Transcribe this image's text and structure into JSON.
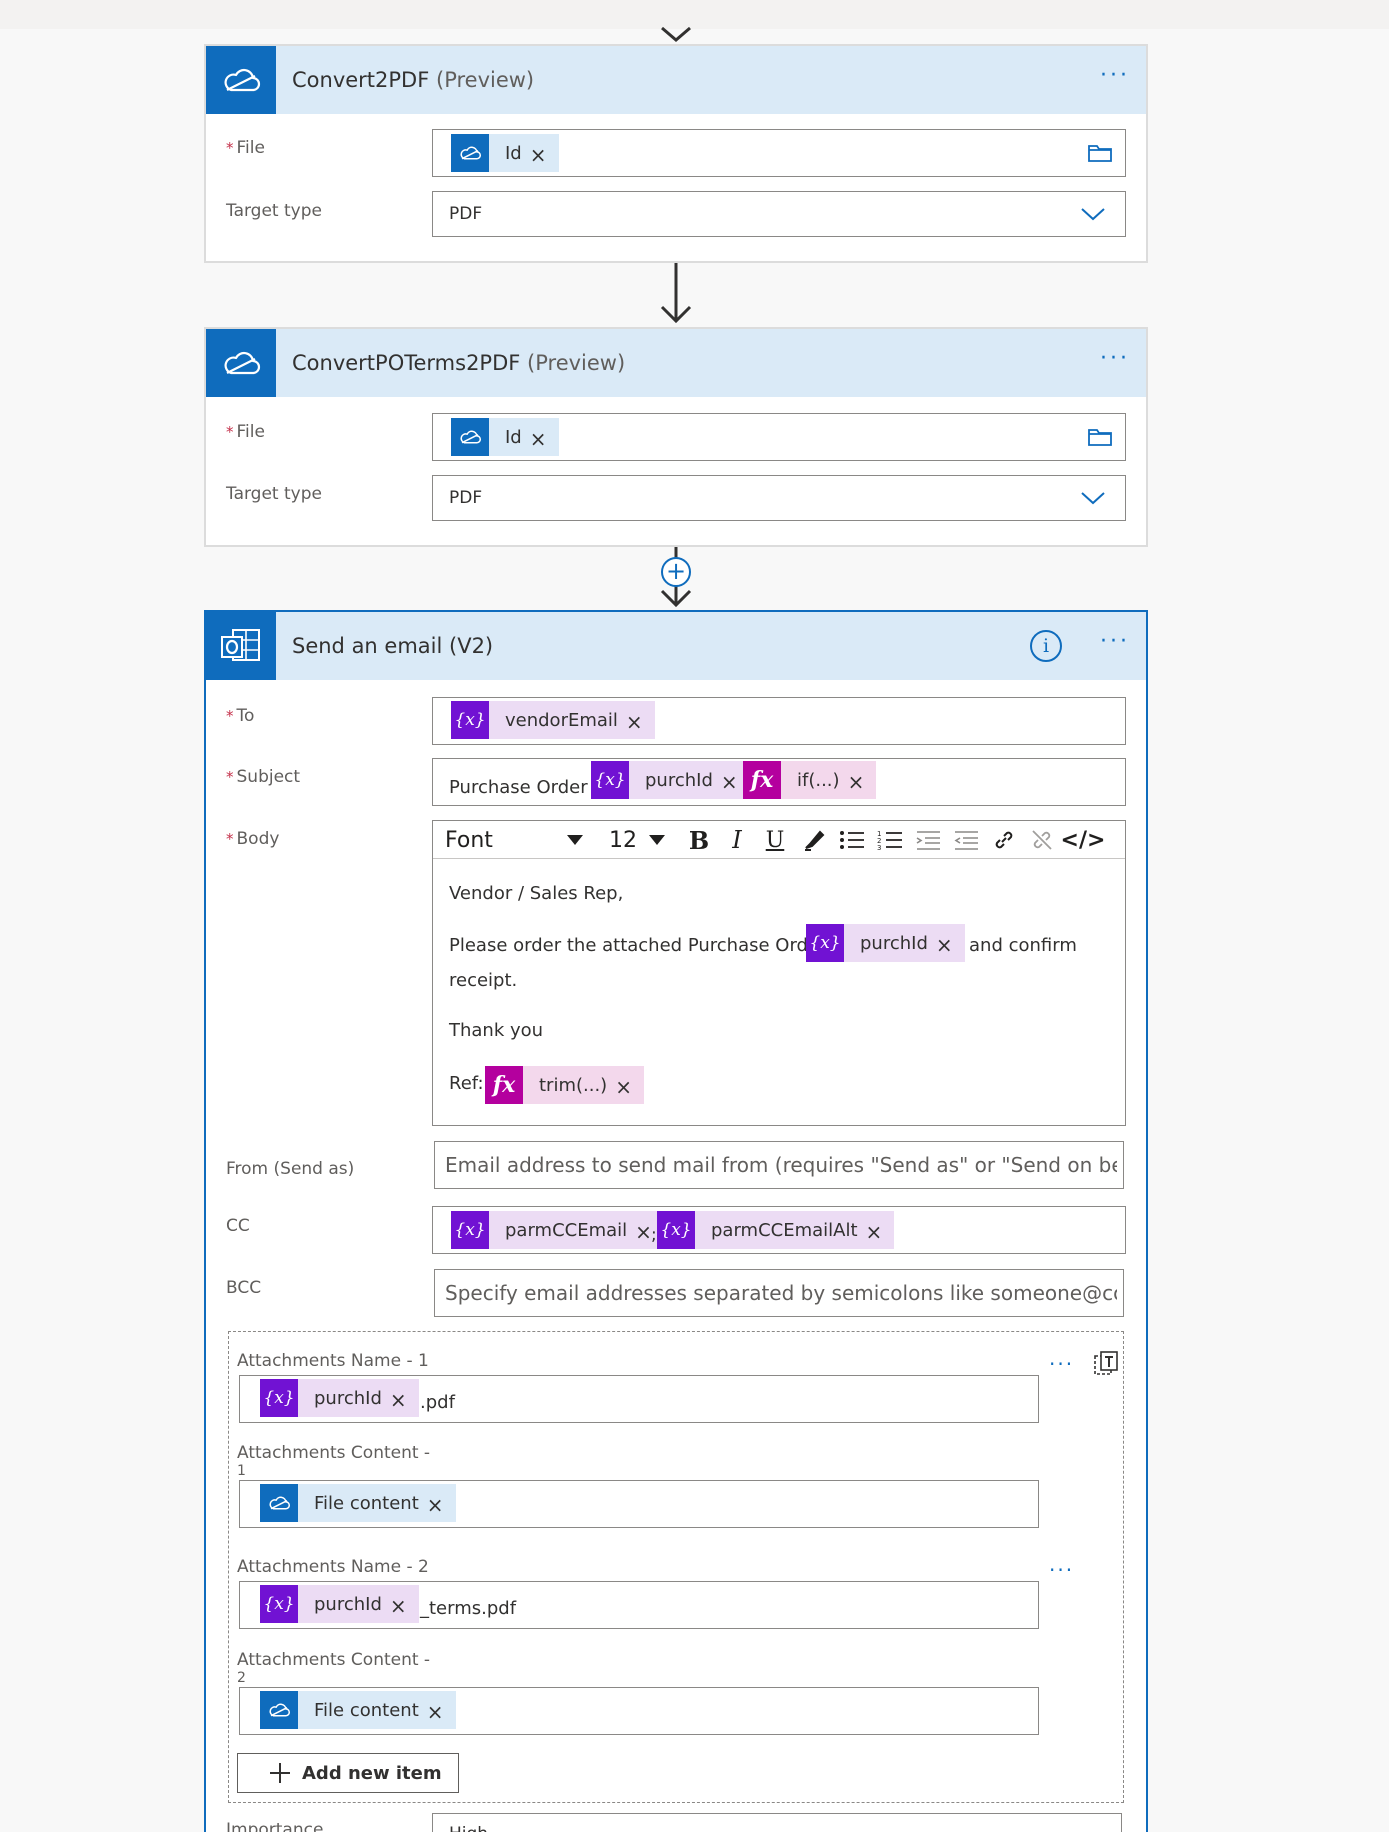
{
  "card1": {
    "title": "Convert2PDF",
    "preview": "(Preview)",
    "file_label": "File",
    "file_token": "Id",
    "target_label": "Target type",
    "target_value": "PDF"
  },
  "card2": {
    "title": "ConvertPOTerms2PDF",
    "preview": "(Preview)",
    "file_label": "File",
    "file_token": "Id",
    "target_label": "Target type",
    "target_value": "PDF"
  },
  "email": {
    "title": "Send an email (V2)",
    "to_label": "To",
    "to_token": "vendorEmail",
    "subject_label": "Subject",
    "subject_prefix": "Purchase Order",
    "subject_token1": "purchId",
    "subject_token2": "if(...)",
    "body_label": "Body",
    "toolbar": {
      "font": "Font",
      "size": "12",
      "bold": "B",
      "italic": "I",
      "underline": "U",
      "code": "</>"
    },
    "body": {
      "line1": "Vendor / Sales Rep,",
      "line2_prefix": "Please order the attached Purchase Order",
      "line2_token": "purchId",
      "line2_suffix": "and confirm",
      "line3": "receipt.",
      "line4": "Thank you",
      "ref_label": "Ref:",
      "ref_token": "trim(...)"
    },
    "from_label": "From (Send as)",
    "from_placeholder": "Email address to send mail from (requires \"Send as\" or \"Send on beh",
    "cc_label": "CC",
    "cc_token1": "parmCCEmail",
    "cc_sep": ";",
    "cc_token2": "parmCCEmailAlt",
    "bcc_label": "BCC",
    "bcc_placeholder": "Specify email addresses separated by semicolons like someone@con",
    "attachments": [
      {
        "name_label": "Attachments Name - 1",
        "name_token": "purchId",
        "name_suffix": ".pdf",
        "content_label": "Attachments Content -",
        "content_num": "1",
        "content_token": "File content"
      },
      {
        "name_label": "Attachments Name - 2",
        "name_token": "purchId",
        "name_suffix": "_terms.pdf",
        "content_label": "Attachments Content -",
        "content_num": "2",
        "content_token": "File content"
      }
    ],
    "add_item": "Add new item",
    "importance_label": "Importance",
    "importance_value": "High"
  },
  "colors": {
    "accent": "#0f6cbd",
    "header_bg": "#daeaf7",
    "variable": "#7112d3",
    "expression": "#b4009e",
    "required": "#c4314b"
  },
  "icons": {
    "onedrive": "cloud-icon",
    "outlook": "outlook-icon",
    "variable": "{x}",
    "expression": "fx"
  }
}
